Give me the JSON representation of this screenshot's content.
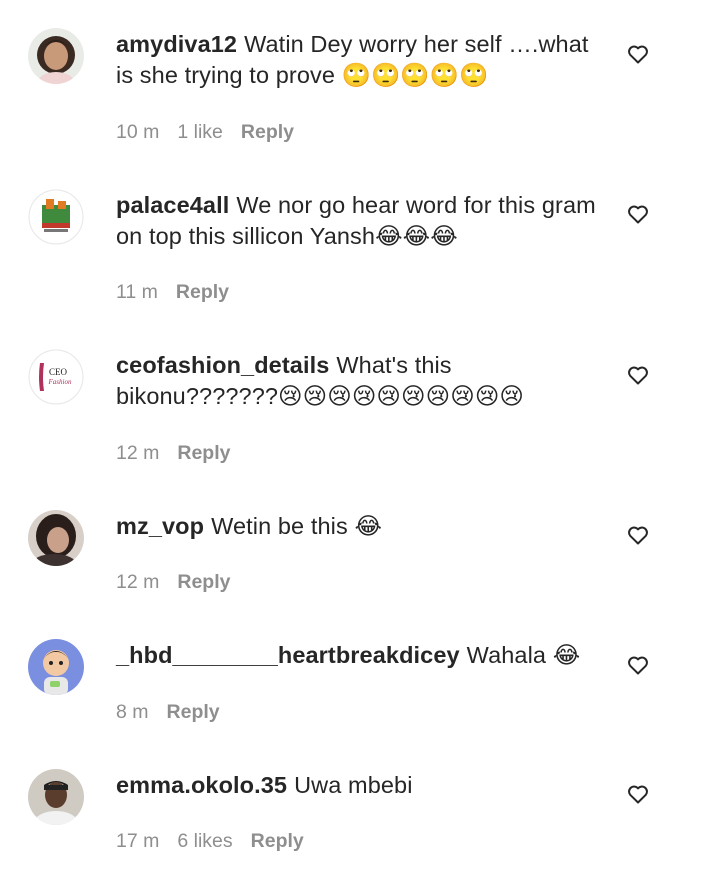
{
  "comments": [
    {
      "username": "amydiva12",
      "text": "Watin Dey worry her self ….what is she trying to prove 🙄🙄🙄🙄🙄",
      "time": "10 m",
      "likes": "1 like",
      "reply": "Reply",
      "avatar_icon": "avatar-woman-photo",
      "avatar_color": "#c89a7a"
    },
    {
      "username": "palace4all",
      "text": "We nor go hear word for this gram on top this sillicon Yansh😂😂😂",
      "time": "11 m",
      "likes": "",
      "reply": "Reply",
      "avatar_icon": "avatar-palace-logo",
      "avatar_color": "#3f8a3c"
    },
    {
      "username": "ceofashion_details",
      "text": "What's this bikonu???????😢😢😢😢😢😢😢😢😢😢",
      "time": "12 m",
      "likes": "",
      "reply": "Reply",
      "avatar_icon": "avatar-ceo-fashion-logo",
      "avatar_color": "#b0325a"
    },
    {
      "username": "mz_vop",
      "text": "Wetin be this 😂",
      "time": "12 m",
      "likes": "",
      "reply": "Reply",
      "avatar_icon": "avatar-woman-photo",
      "avatar_color": "#4a3a36"
    },
    {
      "username": "_hbd________heartbreakdicey",
      "text": "Wahala 😂",
      "time": "8 m",
      "likes": "",
      "reply": "Reply",
      "avatar_icon": "avatar-cartoon-baby",
      "avatar_color": "#7b8fe0"
    },
    {
      "username": "emma.okolo.35",
      "text": "Uwa mbebi",
      "time": "17 m",
      "likes": "6 likes",
      "reply": "Reply",
      "avatar_icon": "avatar-man-photo",
      "avatar_color": "#55524c"
    }
  ],
  "icons": {
    "heart": "heart-outline-icon"
  }
}
